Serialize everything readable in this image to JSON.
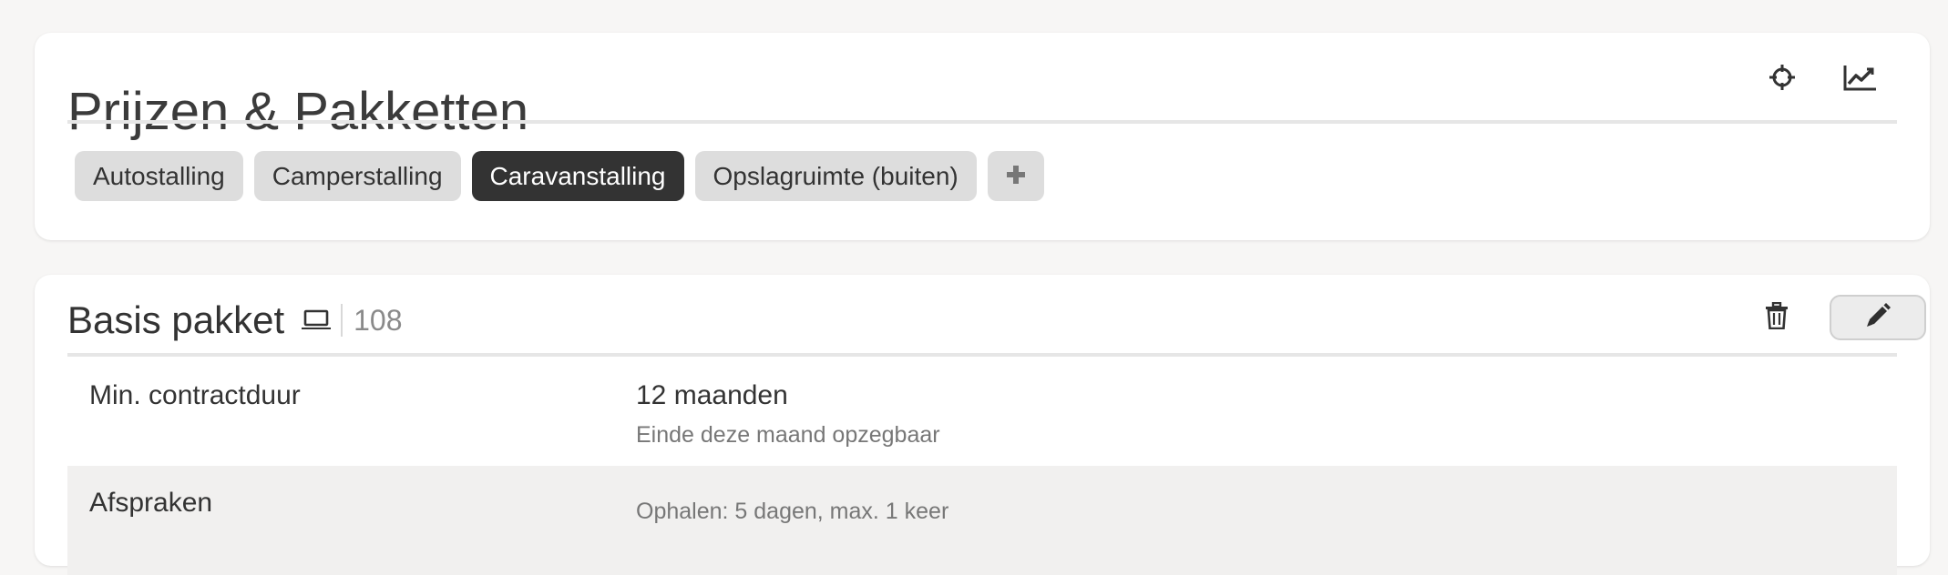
{
  "header": {
    "title": "Prijzen & Pakketten",
    "icons": [
      "crosshair-icon",
      "line-chart-icon"
    ]
  },
  "tabs": {
    "items": [
      {
        "label": "Autostalling",
        "active": false
      },
      {
        "label": "Camperstalling",
        "active": false
      },
      {
        "label": "Caravanstalling",
        "active": true
      },
      {
        "label": "Opslagruimte (buiten)",
        "active": false
      }
    ],
    "add_label": "+"
  },
  "package": {
    "title": "Basis pakket",
    "device_icon": "laptop-icon",
    "count": "108",
    "actions": [
      "trash-icon",
      "pencil-icon"
    ],
    "rows": [
      {
        "label": "Min. contractduur",
        "value": "12 maanden",
        "sub": "Einde deze maand opzegbaar"
      },
      {
        "label": "Afspraken",
        "value": "",
        "sub": "Ophalen: 5 dagen, max. 1 keer"
      }
    ]
  },
  "colors": {
    "background": "#f7f6f5",
    "card": "#ffffff",
    "tab": "#dddddd",
    "tab_active": "#333333",
    "row_alt": "#f1f0ef"
  }
}
